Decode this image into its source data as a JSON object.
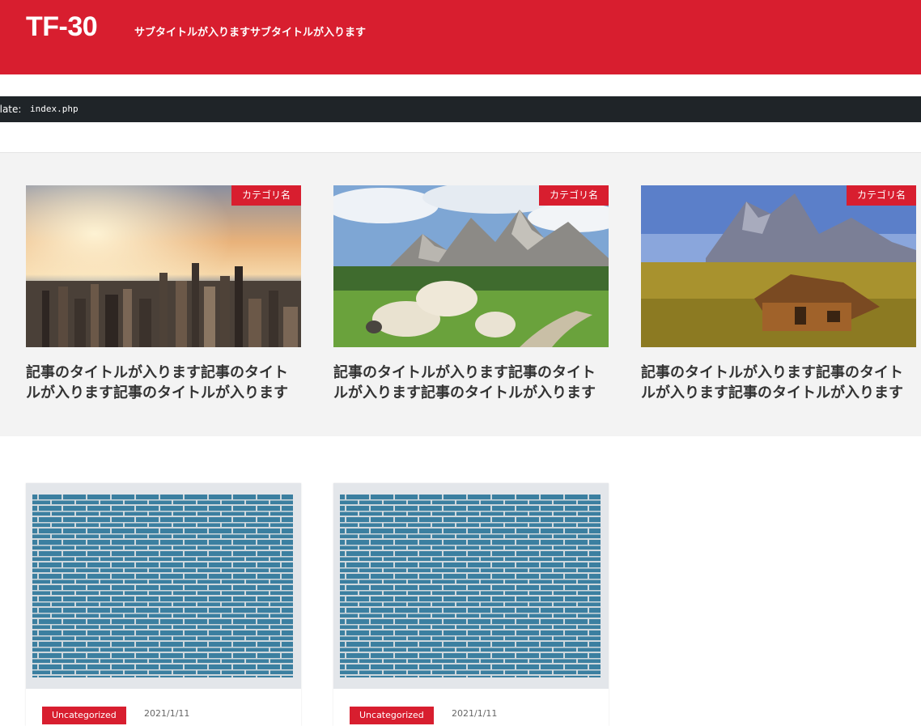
{
  "header": {
    "title": "TF-30",
    "subtitle": "サブタイトルが入りますサブタイトルが入ります",
    "bg_color": "#d81e2f"
  },
  "template_bar": {
    "label": "plate:",
    "file": "index.php"
  },
  "featured": [
    {
      "category": "カテゴリ名",
      "title": "記事のタイトルが入ります記事のタイトルが入ります記事のタイトルが入ります",
      "image": "city-skyline-sunset"
    },
    {
      "category": "カテゴリ名",
      "title": "記事のタイトルが入ります記事のタイトルが入ります記事のタイトルが入ります",
      "image": "sheep-mountains"
    },
    {
      "category": "カテゴリ名",
      "title": "記事のタイトルが入ります記事のタイトルが入ります記事のタイトルが入ります",
      "image": "mountain-cabin"
    }
  ],
  "posts": [
    {
      "category": "Uncategorized",
      "date": "2021/1/11",
      "image": "blue-brick-wall"
    },
    {
      "category": "Uncategorized",
      "date": "2021/1/11",
      "image": "blue-brick-wall"
    }
  ]
}
